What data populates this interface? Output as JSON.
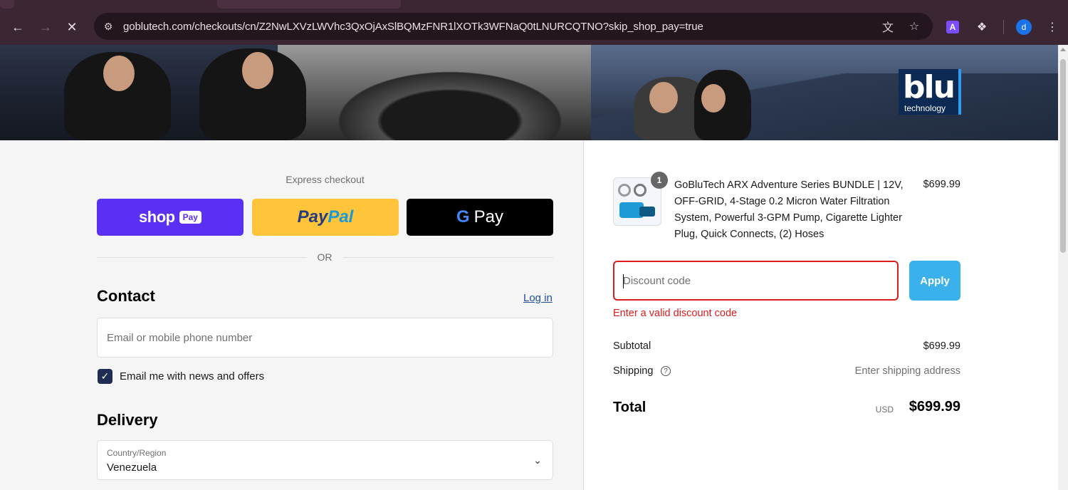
{
  "browser": {
    "url": "goblutech.com/checkouts/cn/Z2NwLXVzLWVhc3QxOjAxSlBQMzFNR1lXOTk3WFNaQ0tLNURCQTNO?skip_shop_pay=true",
    "profile_initial": "d",
    "extension_letter": "A"
  },
  "banner": {
    "logo_word": "blu",
    "logo_sub": "technology"
  },
  "express": {
    "label": "Express checkout",
    "shop_pay": {
      "word": "shop",
      "pill": "Pay"
    },
    "paypal": {
      "part1": "Pay",
      "part2": "Pal"
    },
    "gpay": {
      "g": "G",
      "text": "Pay"
    },
    "or": "OR"
  },
  "contact": {
    "title": "Contact",
    "login": "Log in",
    "email_placeholder": "Email or mobile phone number",
    "newsletter_label": "Email me with news and offers",
    "newsletter_checked": true
  },
  "delivery": {
    "title": "Delivery",
    "country_label": "Country/Region",
    "country_value": "Venezuela"
  },
  "summary": {
    "product": {
      "name": "GoBluTech ARX Adventure Series BUNDLE | 12V, OFF-GRID, 4-Stage 0.2 Micron Water Filtration System, Powerful 3-GPM Pump, Cigarette Lighter Plug, Quick Connects, (2) Hoses",
      "price": "$699.99",
      "quantity": "1"
    },
    "discount": {
      "placeholder": "Discount code",
      "apply": "Apply",
      "error": "Enter a valid discount code"
    },
    "subtotal_label": "Subtotal",
    "subtotal_value": "$699.99",
    "shipping_label": "Shipping",
    "shipping_value": "Enter shipping address",
    "total_label": "Total",
    "total_currency": "USD",
    "total_value": "$699.99"
  }
}
